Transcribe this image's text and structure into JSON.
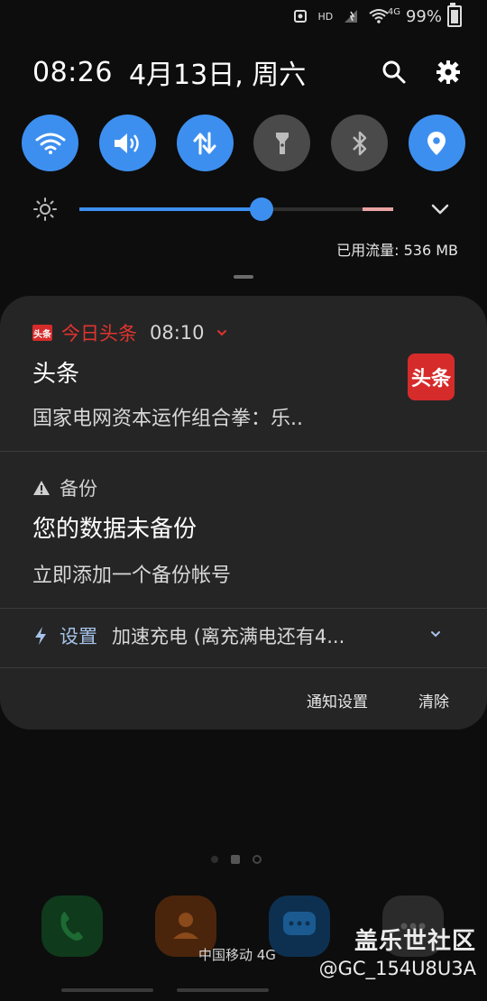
{
  "status_bar": {
    "hd": "HD",
    "network": "4G",
    "battery": "99%"
  },
  "header": {
    "time": "08:26",
    "date": "4月13日, 周六"
  },
  "quick_toggles": [
    {
      "name": "wifi",
      "state": "on"
    },
    {
      "name": "sound",
      "state": "on"
    },
    {
      "name": "mobile-data",
      "state": "on"
    },
    {
      "name": "flashlight",
      "state": "off"
    },
    {
      "name": "bluetooth",
      "state": "off"
    },
    {
      "name": "location",
      "state": "on"
    }
  ],
  "brightness": {
    "level": 0.58
  },
  "data_usage": "已用流量: 536 MB",
  "notifications": [
    {
      "app": "今日头条",
      "time": "08:10",
      "title": "头条",
      "body": "国家电网资本运作组合拳：乐..",
      "badge_text": "头条",
      "icon_text": "头条"
    },
    {
      "app": "备份",
      "title": "您的数据未备份",
      "body": "立即添加一个备份帐号"
    },
    {
      "app": "设置",
      "text": "加速充电 (离充满电还有4..."
    }
  ],
  "actions": {
    "settings": "通知设置",
    "clear": "清除"
  },
  "carrier": "中国移动 4G",
  "watermark": {
    "line1": "盖乐世社区",
    "line2": "@GC_154U8U3A"
  },
  "colors": {
    "accent": "#3d8fef",
    "toutiao_red": "#d62b2b"
  }
}
